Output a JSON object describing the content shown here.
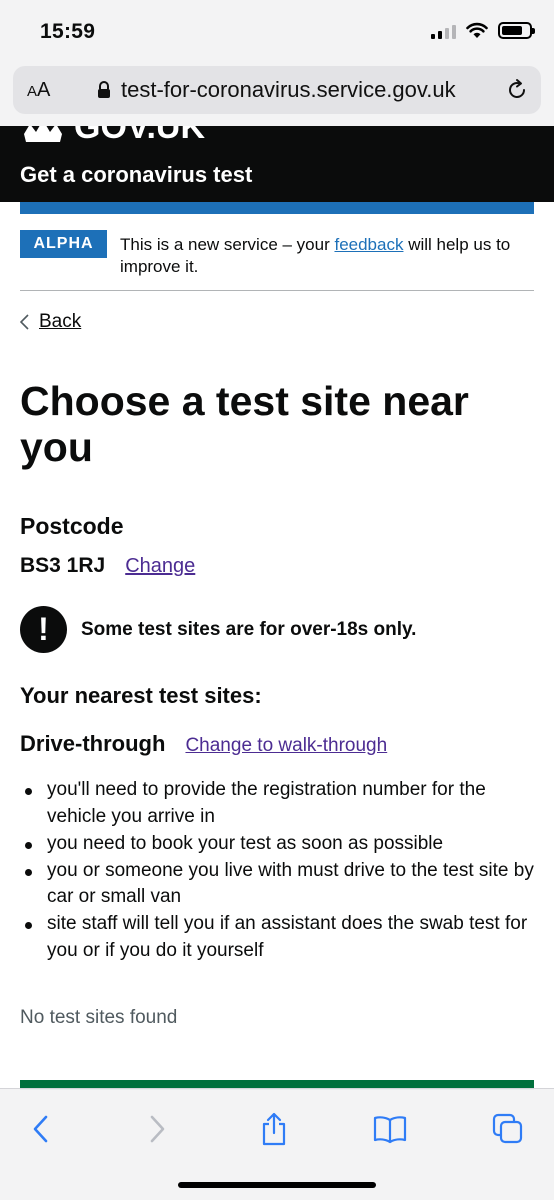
{
  "status_bar": {
    "time": "15:59"
  },
  "browser": {
    "text_size_label": "AA",
    "url": "test-for-coronavirus.service.gov.uk",
    "toolbar": {
      "back": "back-icon",
      "forward": "forward-icon",
      "share": "share-icon",
      "bookmarks": "book-icon",
      "tabs": "tabs-icon"
    }
  },
  "header": {
    "logo_text": "GOV.UK",
    "service_name": "Get a coronavirus test",
    "brand_color": "#1d70b8"
  },
  "phase_banner": {
    "tag": "ALPHA",
    "text_before": "This is a new service – your ",
    "link": "feedback",
    "text_after": " will help us to improve it."
  },
  "back_link": "Back",
  "page": {
    "title": "Choose a test site near you",
    "postcode_label": "Postcode",
    "postcode_value": "BS3 1RJ",
    "change_link": "Change",
    "warning": "Some test sites are for over-18s only.",
    "nearest_heading": "Your nearest test sites:",
    "mode_label": "Drive-through",
    "mode_change_link": "Change to walk-through",
    "bullets": [
      "you'll need to provide the registration number for the vehicle you arrive in",
      "you need to book your test as soon as possible",
      "you or someone you live with must drive to the test site by car or small van",
      "site staff will tell you if an assistant does the swab test for you or if you do it yourself"
    ],
    "no_results": "No test sites found"
  }
}
